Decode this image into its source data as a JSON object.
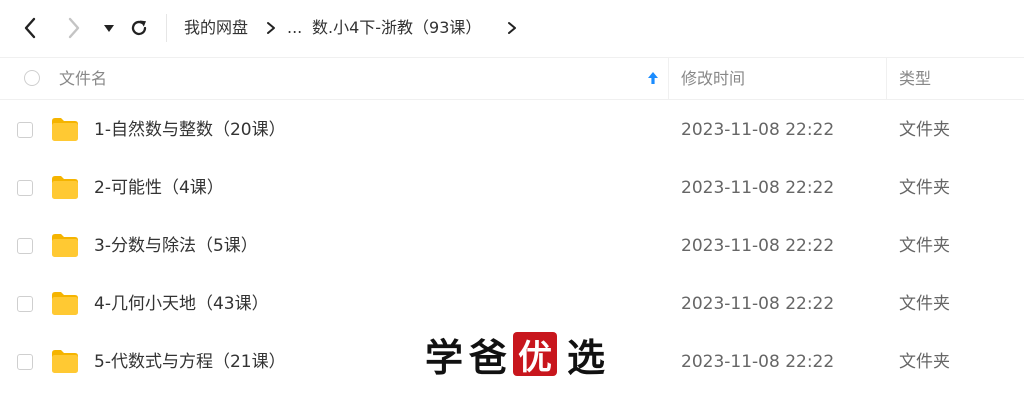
{
  "toolbar": {
    "icons": [
      "back-arrow-icon",
      "forward-arrow-icon",
      "dropdown-caret-icon",
      "refresh-icon"
    ]
  },
  "breadcrumb": {
    "root": "我的网盘",
    "ellipsis": "...",
    "current": "数.小4下-浙教（93课）"
  },
  "table": {
    "columns": {
      "name": "文件名",
      "modified": "修改时间",
      "type": "类型"
    },
    "sort_icon": "sort-asc-icon",
    "rows": [
      {
        "name": "1-自然数与整数（20课）",
        "modified": "2023-11-08 22:22",
        "type": "文件夹"
      },
      {
        "name": "2-可能性（4课）",
        "modified": "2023-11-08 22:22",
        "type": "文件夹"
      },
      {
        "name": "3-分数与除法（5课）",
        "modified": "2023-11-08 22:22",
        "type": "文件夹"
      },
      {
        "name": "4-几何小天地（43课）",
        "modified": "2023-11-08 22:22",
        "type": "文件夹"
      },
      {
        "name": "5-代数式与方程（21课）",
        "modified": "2023-11-08 22:22",
        "type": "文件夹"
      }
    ]
  },
  "watermark": {
    "chars": [
      "学",
      "爸",
      "优",
      "选"
    ]
  },
  "colors": {
    "folder": "#ffc933",
    "folder_dark": "#f5b400",
    "sort_arrow": "#1a8cff",
    "seal": "#c8161d"
  }
}
